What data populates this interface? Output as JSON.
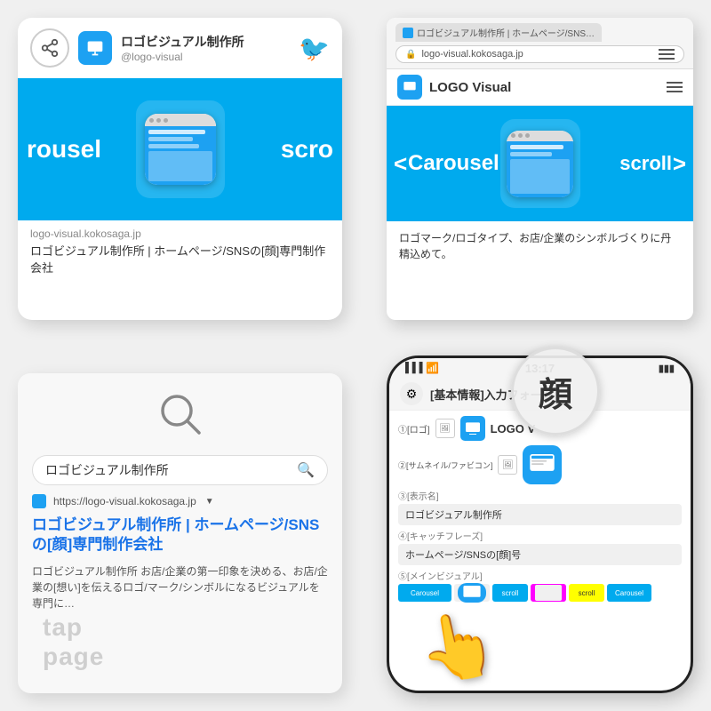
{
  "topLeft": {
    "accountName": "ロゴビジュアル制作所",
    "accountHandle": "@logo-visual",
    "shareIconLabel": "share",
    "twitterIconLabel": "twitter",
    "bannerTextLeft": "rousel",
    "bannerTextRight": "scro",
    "footerUrl": "logo-visual.kokosaga.jp",
    "footerTitle": "ロゴビジュアル制作所 | ホームページ/SNSの[顔]専門制作会社"
  },
  "topRight": {
    "tabTitle": "ロゴビジュアル制作所 | ホームページ/SNSの[顔]専門制作会社",
    "addressBarUrl": "logo-visual.kokosaga.jp",
    "navTitle": "LOGO Visual",
    "carouselTextLeft": "Carousel",
    "carouselTextRight": "scroll",
    "bodyText": "ロゴマーク/ロゴタイプ、お店/企業のシンボルづくりに丹精込めて。"
  },
  "bottomLeft": {
    "searchQuery": "ロゴビジュアル制作所",
    "resultUrl": "https://logo-visual.kokosaga.jp",
    "resultTitle": "ロゴビジュアル制作所 | ホームページ/SNSの[顔]専門制作会社",
    "resultDesc": "ロゴビジュアル制作所 お店/企業の第一印象を決める、お店/企業の[想い]を伝えるロゴ/マーク/シンボルになるビジュアルを専門に…",
    "tapPageLabel1": "tap",
    "tapPageLabel2": "page"
  },
  "bottomRight": {
    "statusTime": "13:17",
    "statusSignal": "▌▌▌",
    "statusWifi": "wifi",
    "statusBattery": "🔋",
    "formTitle": "[基本情報]入力フォーム",
    "field1Label": "①[ロゴ]",
    "field1Value": "LOGO V",
    "field2Label": "②[サムネイル/ファビコン]",
    "field3Label": "③[表示名]",
    "field3Value": "ロゴビジュアル制作所",
    "field4Label": "④[キャッチフレーズ]",
    "field4Value": "ホームページ/SNSの[顔]号",
    "field5Label": "⑤[メインビジュアル]",
    "kanjiText": "顔",
    "miniItems": [
      "Carousel",
      "scroll",
      "scroll",
      "Carousel"
    ]
  }
}
